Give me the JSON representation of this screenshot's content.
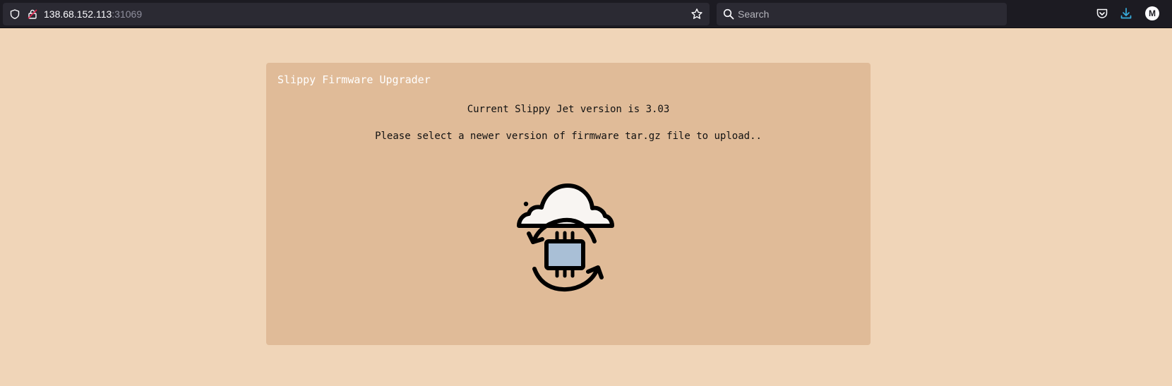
{
  "browser": {
    "url_host": "138.68.152.113",
    "url_port": ":31069",
    "search_placeholder": "Search",
    "avatar_initial": "M"
  },
  "app": {
    "title": "Slippy Firmware Upgrader",
    "version_text": "Current Slippy Jet version is 3.03",
    "instructions": "Please select a newer version of firmware tar.gz file to upload.."
  },
  "icons": {
    "upload": "firmware-upload-icon",
    "toolbar": [
      "shield-icon",
      "lock-icon",
      "star-icon",
      "search-icon",
      "pocket-icon",
      "download-icon"
    ]
  },
  "colors": {
    "page_background": "#f0d5b8",
    "card_background": "#e0bb98",
    "chip": "#a9bfd6",
    "cloud": "#f8f5f2",
    "download_accent": "#38aede"
  }
}
